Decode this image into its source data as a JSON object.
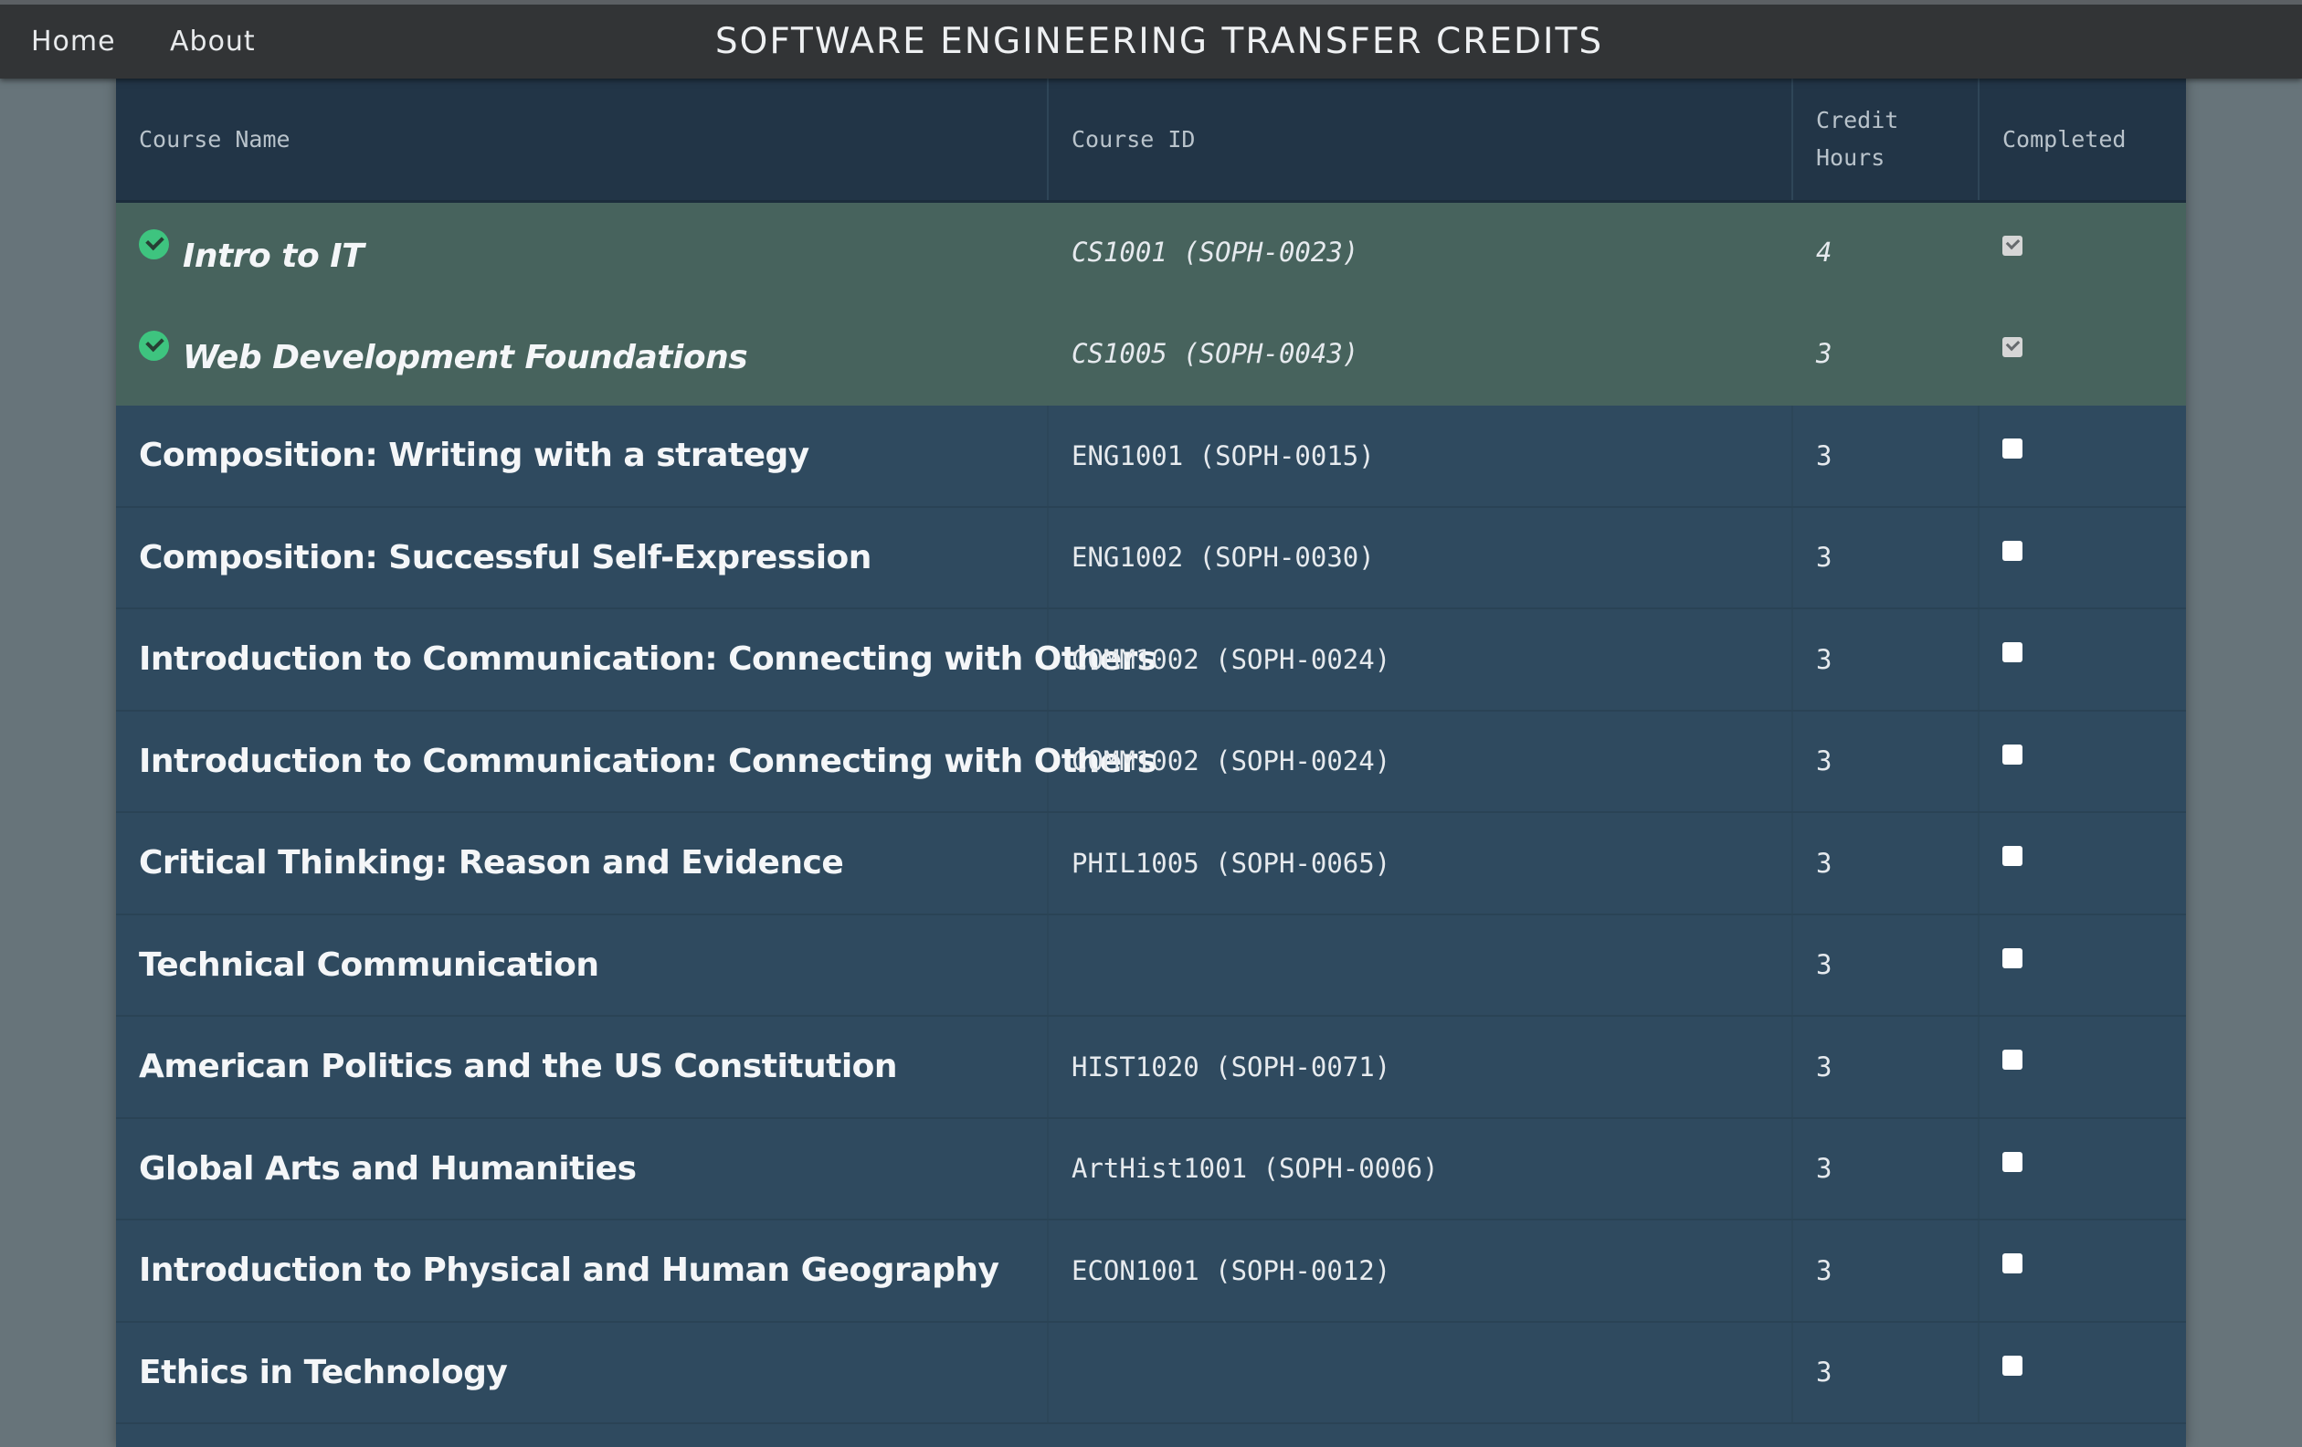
{
  "nav": {
    "home_label": "Home",
    "about_label": "About",
    "title": "SOFTWARE ENGINEERING TRANSFER CREDITS"
  },
  "table": {
    "headers": {
      "course_name": "Course Name",
      "course_id": "Course ID",
      "credit_hours_line1": "Credit",
      "credit_hours_line2": "Hours",
      "completed": "Completed"
    },
    "rows": [
      {
        "name": "Intro to IT",
        "id": "CS1001 (SOPH-0023)",
        "hours": "4",
        "completed": true
      },
      {
        "name": "Web Development Foundations",
        "id": "CS1005 (SOPH-0043)",
        "hours": "3",
        "completed": true
      },
      {
        "name": "Composition: Writing with a strategy",
        "id": "ENG1001 (SOPH-0015)",
        "hours": "3",
        "completed": false
      },
      {
        "name": "Composition: Successful Self-Expression",
        "id": "ENG1002 (SOPH-0030)",
        "hours": "3",
        "completed": false
      },
      {
        "name": "Introduction to Communication: Connecting with Others",
        "id": "COMM1002 (SOPH-0024)",
        "hours": "3",
        "completed": false
      },
      {
        "name": "Introduction to Communication: Connecting with Others",
        "id": "COMM1002 (SOPH-0024)",
        "hours": "3",
        "completed": false
      },
      {
        "name": "Critical Thinking: Reason and Evidence",
        "id": "PHIL1005 (SOPH-0065)",
        "hours": "3",
        "completed": false
      },
      {
        "name": "Technical Communication",
        "id": "",
        "hours": "3",
        "completed": false
      },
      {
        "name": "American Politics and the US Constitution",
        "id": "HIST1020 (SOPH-0071)",
        "hours": "3",
        "completed": false
      },
      {
        "name": "Global Arts and Humanities",
        "id": "ArtHist1001 (SOPH-0006)",
        "hours": "3",
        "completed": false
      },
      {
        "name": "Introduction to Physical and Human Geography",
        "id": "ECON1001 (SOPH-0012)",
        "hours": "3",
        "completed": false
      },
      {
        "name": "Ethics in Technology",
        "id": "",
        "hours": "3",
        "completed": false
      }
    ]
  },
  "colors": {
    "page_bg": "#67747a",
    "topbar": "#323436",
    "table_header": "#223547",
    "table_body": "#2f4a5f",
    "completed_row": "#47635d",
    "completed_icon": "#3ec47f"
  }
}
